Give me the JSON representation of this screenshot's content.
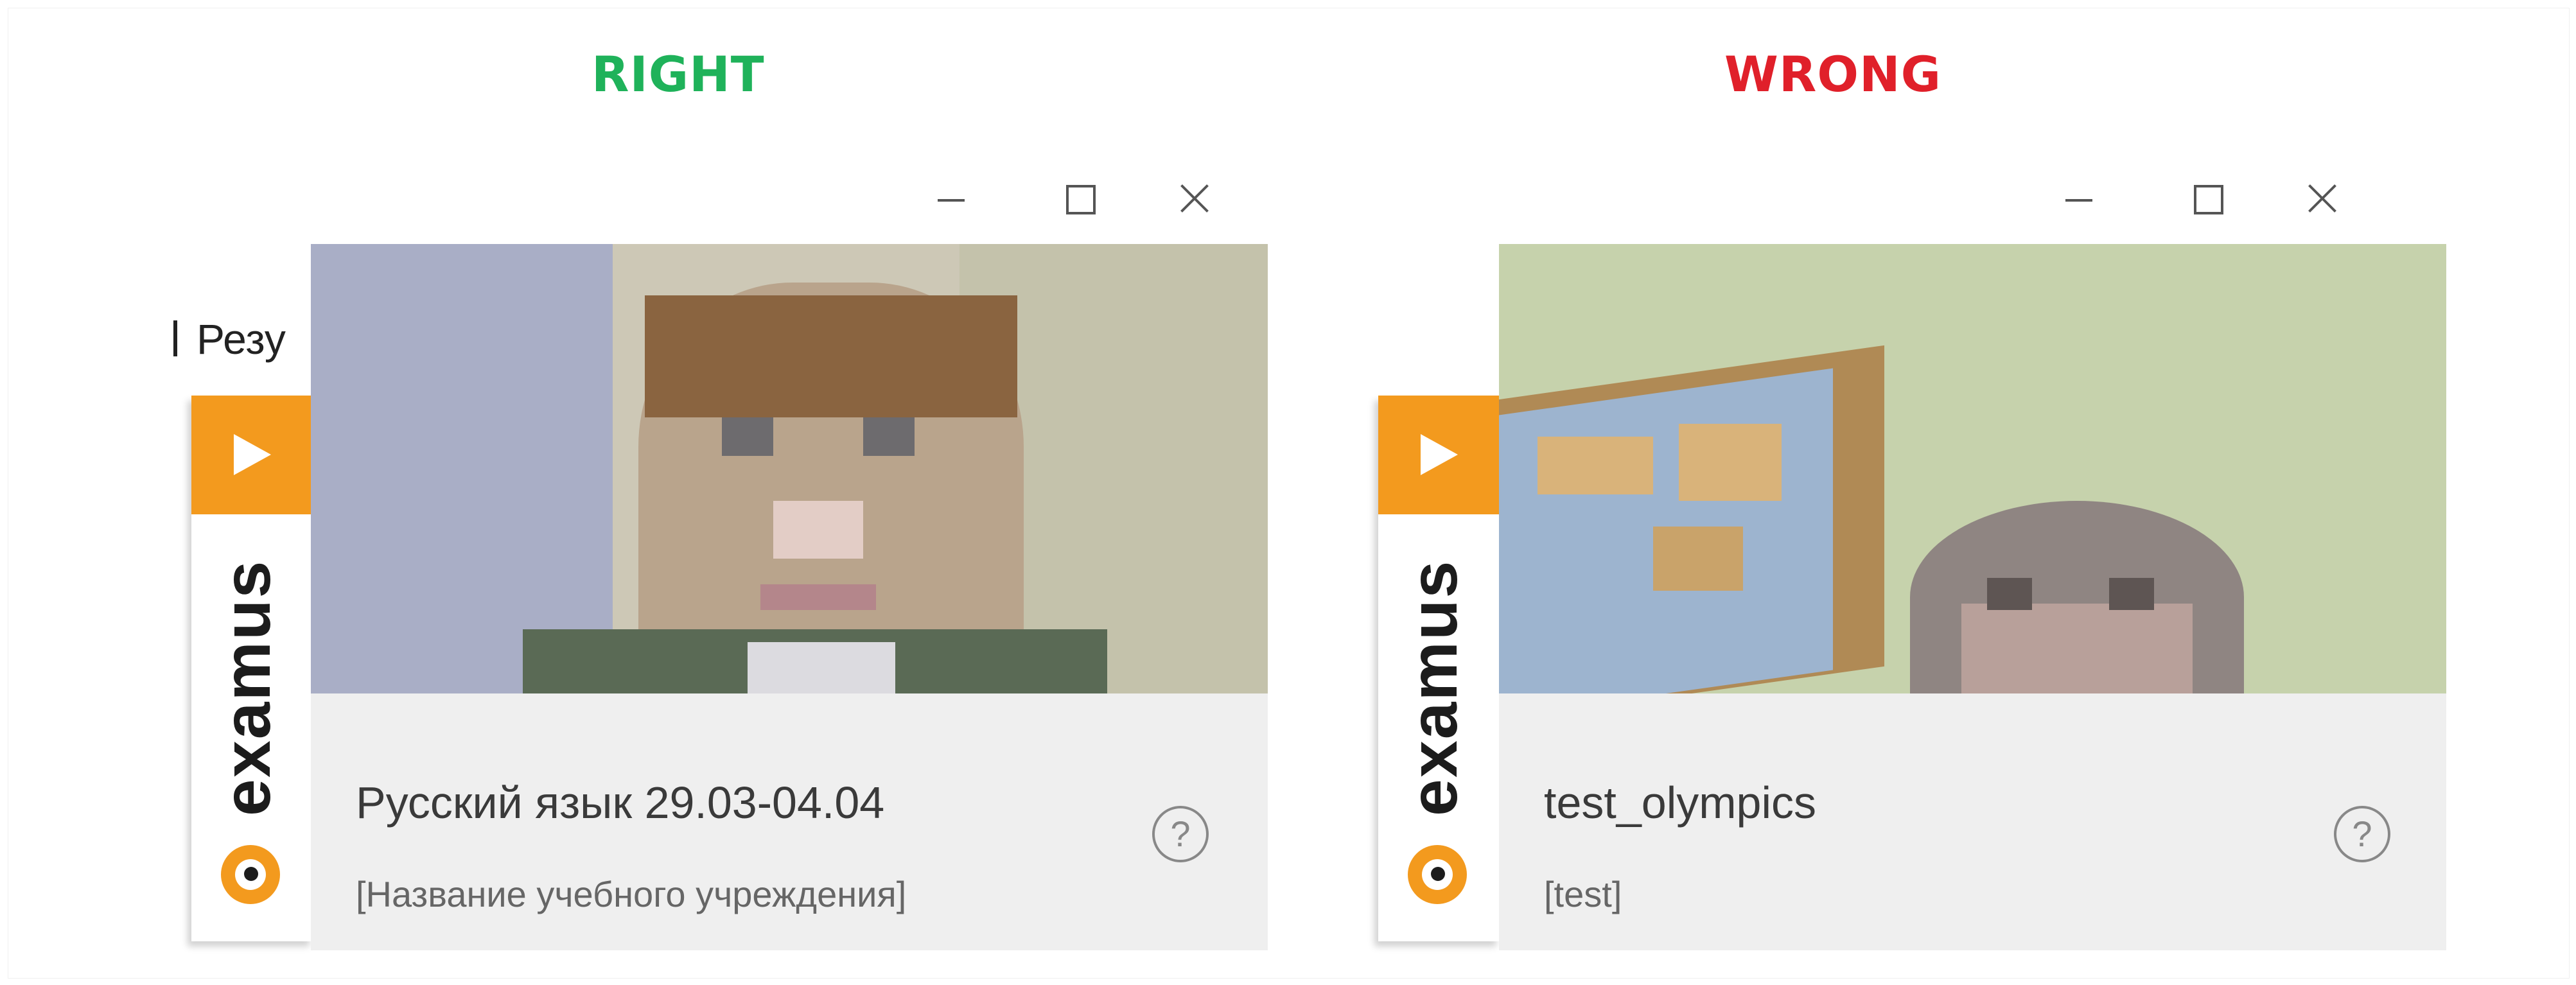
{
  "captions": {
    "right": "RIGHT",
    "wrong": "WRONG"
  },
  "colors": {
    "right": "#1fb25a",
    "wrong": "#e0202a",
    "brand_orange": "#f39a1e",
    "info_bg": "#efefef"
  },
  "window_controls": {
    "minimize_icon": "minimize-icon",
    "maximize_icon": "maximize-icon",
    "close_icon": "close-icon"
  },
  "panels": [
    {
      "behind_text": "Резу",
      "brand": "examus",
      "exam_title": "Русский язык 29.03-04.04",
      "institution": "[Название учебного учреждения]",
      "help_glyph": "?"
    },
    {
      "brand": "examus",
      "exam_title": "test_olympics",
      "institution": "[test]",
      "help_glyph": "?"
    }
  ]
}
